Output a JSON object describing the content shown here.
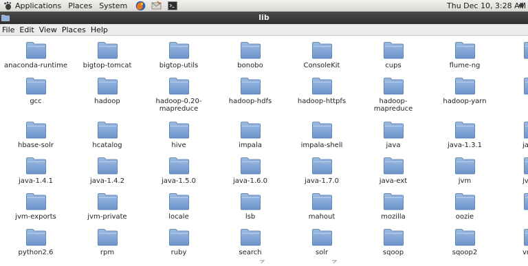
{
  "panel": {
    "applications": "Applications",
    "places": "Places",
    "system": "System",
    "clock": "Thu Dec 10,  3:28 AM",
    "launchers": [
      "firefox-icon",
      "email-client-icon",
      "terminal-icon"
    ]
  },
  "window": {
    "title": "lib"
  },
  "menubar": {
    "items": [
      "File",
      "Edit",
      "View",
      "Places",
      "Help"
    ]
  },
  "colors": {
    "folder_top": "#9dbbe2",
    "folder_bottom": "#6c95cc",
    "folder_edge": "#4d74a8",
    "titlebar": "#3b3b3b"
  },
  "files": {
    "rows": [
      [
        "anaconda-runtime",
        "bigtop-tomcat",
        "bigtop-utils",
        "bonobo",
        "ConsoleKit",
        "cups",
        "flume-ng",
        ""
      ],
      [
        "gcc",
        "hadoop",
        "hadoop-0.20-mapreduce",
        "hadoop-hdfs",
        "hadoop-httpfs",
        "hadoop-mapreduce",
        "hadoop-yarn",
        ""
      ],
      [
        "hbase-solr",
        "hcatalog",
        "hive",
        "impala",
        "impala-shell",
        "java",
        "java-1.3.1",
        "ja"
      ],
      [
        "java-1.4.1",
        "java-1.4.2",
        "java-1.5.0",
        "java-1.6.0",
        "java-1.7.0",
        "java-ext",
        "jvm",
        "jvm-"
      ],
      [
        "jvm-exports",
        "jvm-private",
        "locale",
        "lsb",
        "mahout",
        "mozilla",
        "oozie",
        ""
      ],
      [
        "python2.6",
        "rpm",
        "ruby",
        "search",
        "solr",
        "sqoop",
        "sqoop2",
        "vm"
      ]
    ]
  }
}
